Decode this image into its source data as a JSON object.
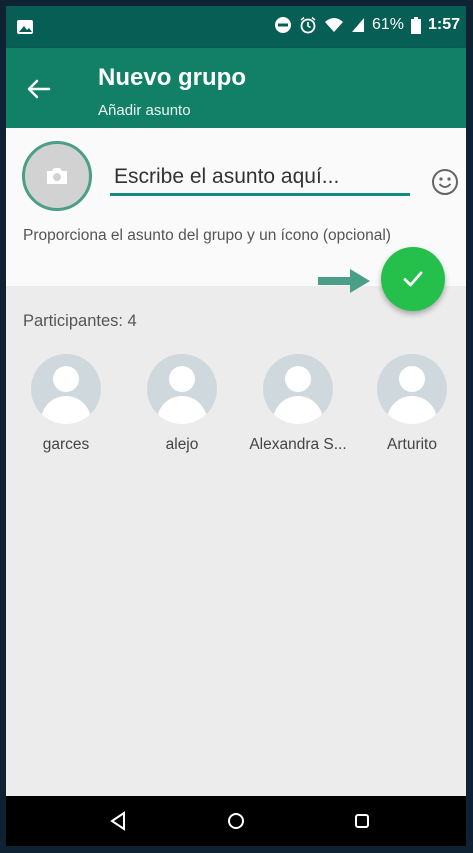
{
  "status_bar": {
    "battery_percent": "61%",
    "time": "1:57",
    "icons": [
      "gallery-icon",
      "do-not-disturb-icon",
      "alarm-icon",
      "wifi-icon",
      "signal-icon",
      "battery-icon"
    ]
  },
  "app_bar": {
    "back_icon": "arrow-left-icon",
    "title": "Nuevo grupo",
    "subtitle": "Añadir asunto"
  },
  "subject": {
    "placeholder": "Escribe el asunto aquí...",
    "value": "",
    "hint": "Proporciona el asunto del grupo y un ícono (opcional)",
    "camera_icon": "camera-icon",
    "emoji_icon": "emoji-icon"
  },
  "participants": {
    "label": "Participantes: 4",
    "items": [
      {
        "name": "garces"
      },
      {
        "name": "alejo"
      },
      {
        "name": "Alexandra S..."
      },
      {
        "name": "Arturito"
      }
    ]
  },
  "fab": {
    "icon": "check-icon"
  },
  "colors": {
    "primary": "#075e54",
    "app_bar": "#128066",
    "accent": "#25c04b",
    "annotation_arrow": "#4a9f86"
  },
  "nav": [
    "back-triangle-icon",
    "home-circle-icon",
    "recents-square-icon"
  ]
}
